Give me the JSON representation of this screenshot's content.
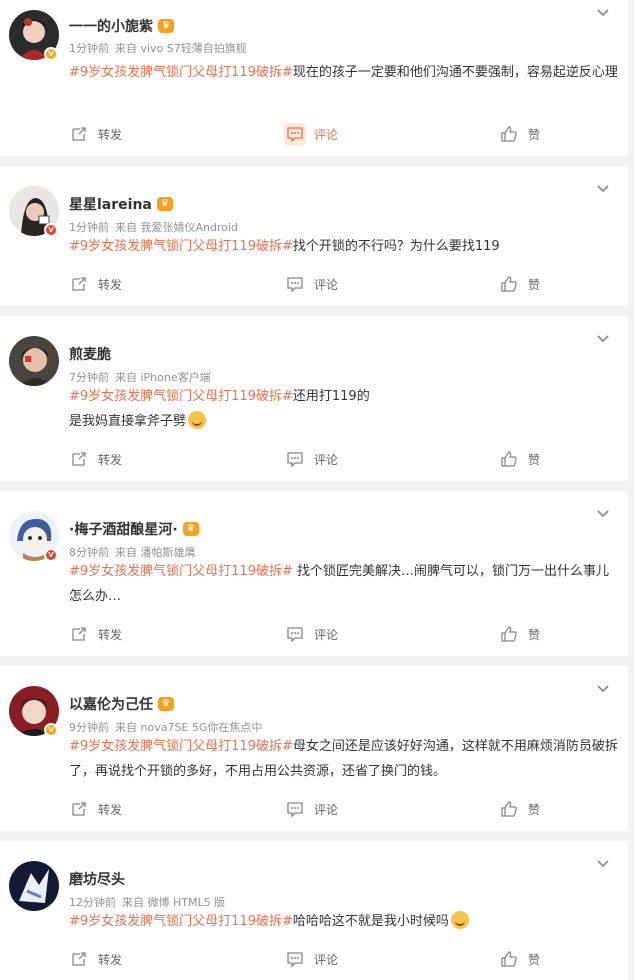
{
  "actions": {
    "repost": "转发",
    "comment": "评论",
    "like": "赞"
  },
  "posts": [
    {
      "name": "一一的小旎紫",
      "time": "1分钟前",
      "source": "来自 vivo S7轻薄自拍旗舰",
      "topic": "#9岁女孩发脾气锁门父母打119破拆#",
      "text": "现在的孩子一定要和他们沟通不要强制，容易起逆反心理",
      "text_line2": "",
      "badge": "orange",
      "crown": true,
      "comment_active": true
    },
    {
      "name": "星星lareina",
      "time": "1分钟前",
      "source": "来自 我爱张婧仪Android",
      "topic": "#9岁女孩发脾气锁门父母打119破拆#",
      "text": "找个开锁的不行吗？为什么要找119",
      "text_line2": "",
      "badge": "red",
      "crown": true,
      "comment_active": false
    },
    {
      "name": "煎麦脆",
      "time": "7分钟前",
      "source": "来自 iPhone客户端",
      "topic": "#9岁女孩发脾气锁门父母打119破拆#",
      "text": "还用打119的",
      "text_line2": "是我妈直接拿斧子劈",
      "badge": "",
      "crown": false,
      "comment_active": false
    },
    {
      "name": "·梅子酒甜酿星河·",
      "time": "8分钟前",
      "source": "来自 潘帕斯雄鹰",
      "topic": "#9岁女孩发脾气锁门父母打119破拆#",
      "text": " 找个锁匠完美解决…闹脾气可以，锁门万一出什么事儿怎么办…",
      "text_line2": "",
      "badge": "red",
      "crown": true,
      "comment_active": false
    },
    {
      "name": "以嘉伦为己任",
      "time": "9分钟前",
      "source": "来自 nova7SE 5G你在焦点中",
      "topic": "#9岁女孩发脾气锁门父母打119破拆#",
      "text": "母女之间还是应该好好沟通，这样就不用麻烦消防员破拆了，再说找个开锁的多好，不用占用公共资源，还省了换门的钱。",
      "text_line2": "",
      "badge": "orange",
      "crown": true,
      "comment_active": false
    },
    {
      "name": "磨坊尽头",
      "time": "12分钟前",
      "source": "来自 微博 HTML5 版",
      "topic": "#9岁女孩发脾气锁门父母打119破拆#",
      "text": "哈哈哈这不就是我小时候吗",
      "text_line2": "",
      "badge": "",
      "crown": false,
      "comment_active": false
    }
  ]
}
